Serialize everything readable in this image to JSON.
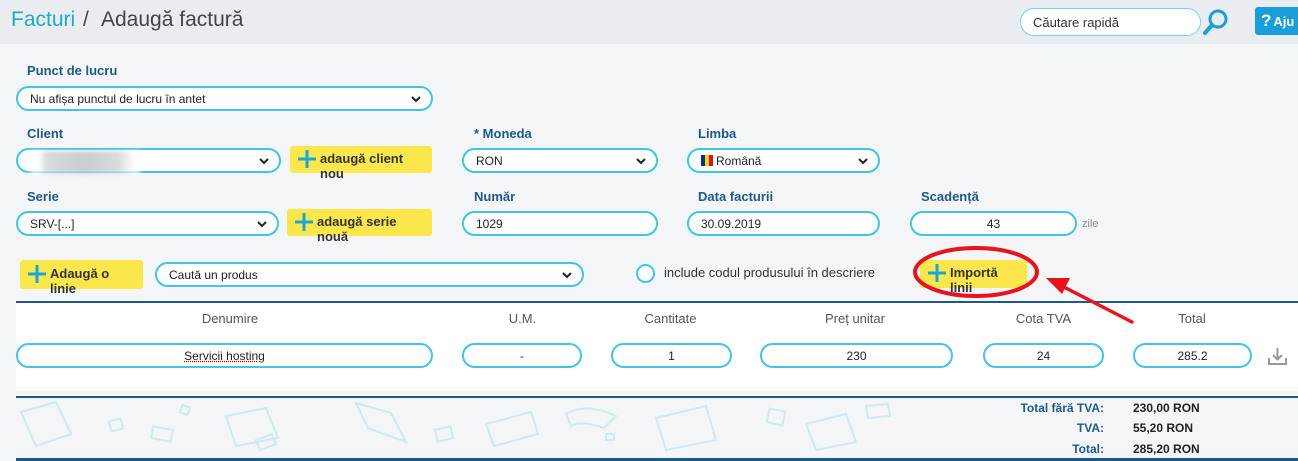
{
  "header": {
    "breadcrumb_link": "Facturi",
    "breadcrumb_sep": "/",
    "page_title": "Adaugă factură",
    "search_placeholder": "Căutare rapidă",
    "help_label": "Aju"
  },
  "form": {
    "punct_label": "Punct de lucru",
    "punct_value": "Nu afișa punctul de lucru în antet",
    "client_label": "Client",
    "client_add": "adaugă client nou",
    "moneda_label": "* Moneda",
    "moneda_value": "RON",
    "limba_label": "Limba",
    "limba_value": "Română",
    "serie_label": "Serie",
    "serie_value": "SRV-[...]",
    "serie_add": "adaugă serie nouă",
    "numar_label": "Număr",
    "numar_value": "1029",
    "data_label": "Data facturii",
    "data_value": "30.09.2019",
    "scadenta_label": "Scadență",
    "scadenta_value": "43",
    "zile": "zile"
  },
  "toolbar": {
    "add_line": "Adaugă o linie",
    "product_search": "Caută un produs",
    "include_code": "include codul produsului în descriere",
    "import_lines": "Importă linii"
  },
  "table": {
    "headers": [
      "Denumire",
      "U.M.",
      "Cantitate",
      "Preț unitar",
      "Cota TVA",
      "Total"
    ],
    "row": {
      "denumire": "Servicii hosting",
      "um": "-",
      "cantitate": "1",
      "pret": "230",
      "cota": "24",
      "total": "285.2"
    }
  },
  "totals": {
    "fara_tva_label": "Total fără TVA:",
    "fara_tva_value": "230,00 RON",
    "tva_label": "TVA:",
    "tva_value": "55,20 RON",
    "total_label": "Total:",
    "total_value": "285,20 RON"
  },
  "colors": {
    "accent": "#40c5e6",
    "label": "#1d5a8a",
    "yellow_button": "#fbe74b",
    "annotation": "#e8131c"
  },
  "icons": [
    "search-icon",
    "help-icon",
    "chevron-down-icon",
    "plus-icon",
    "download-icon",
    "romania-flag-icon"
  ]
}
